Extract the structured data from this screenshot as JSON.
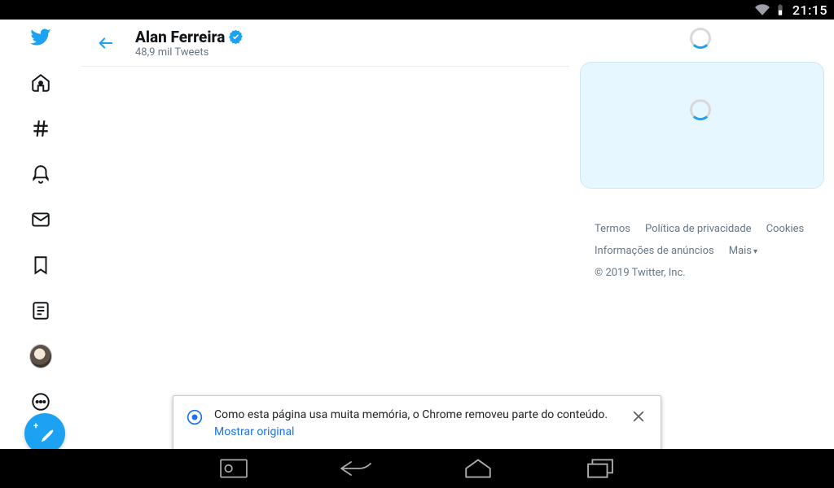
{
  "statusbar": {
    "time": "21:15"
  },
  "header": {
    "name": "Alan Ferreira",
    "subtitle": "48,9 mil Tweets"
  },
  "footer": {
    "terms": "Termos",
    "privacy": "Política de privacidade",
    "cookies": "Cookies",
    "ads": "Informações de anúncios",
    "more": "Mais",
    "copyright": "© 2019 Twitter, Inc."
  },
  "toast": {
    "message": "Como esta página usa muita memória, o Chrome removeu parte do conteúdo.",
    "link": "Mostrar original"
  }
}
